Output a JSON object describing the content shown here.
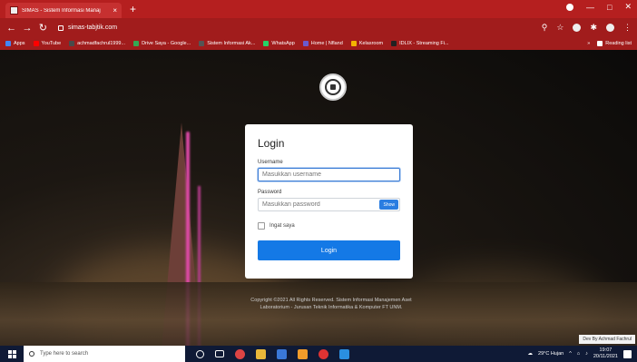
{
  "browser": {
    "tab_title": "SIMAS - Sistem Informasi Manaj",
    "tab_close": "×",
    "new_tab": "+",
    "url": "simas-tabjtik.com",
    "window_controls": [
      "—",
      "□",
      "✕"
    ]
  },
  "bookmarks": {
    "items": [
      {
        "label": "Apps",
        "color": "#4285f4"
      },
      {
        "label": "YouTube",
        "color": "#ff0000"
      },
      {
        "label": "achmadfachrul1999...",
        "color": "#4a4a4a"
      },
      {
        "label": "Drive Saya - Google...",
        "color": "#34a853"
      },
      {
        "label": "Sistem Informasi Ak...",
        "color": "#555555"
      },
      {
        "label": "WhatsApp",
        "color": "#25d366"
      },
      {
        "label": "Home | Nfland",
        "color": "#6a5acd"
      },
      {
        "label": "Kelasroom",
        "color": "#f4b400"
      },
      {
        "label": "IDLIX - Streaming Fi...",
        "color": "#222222"
      }
    ],
    "overflow": "»",
    "reading_list": "Reading list"
  },
  "login": {
    "title": "Login",
    "username_label": "Username",
    "username_placeholder": "Masukkan username",
    "password_label": "Password",
    "password_placeholder": "Masukkan password",
    "show_button": "Show",
    "remember_label": "Ingat saya",
    "submit_label": "Login"
  },
  "footer": {
    "copyright": "Copyright ©2021 All Rights Reserved. Sistem Informasi Manajemen Aset Laboratorium - Jurusan Teknik Informatika & Komputer FT UNM.",
    "dev_credit": "Dev By Achmad Fachrul"
  },
  "taskbar": {
    "search_placeholder": "Type here to search",
    "weather": "29°C Hujan",
    "time": "19:07",
    "date": "20/11/2021"
  },
  "colors": {
    "chrome_red": "#a11c1c",
    "primary_blue": "#1479e6",
    "taskbar": "#0f1a36"
  }
}
